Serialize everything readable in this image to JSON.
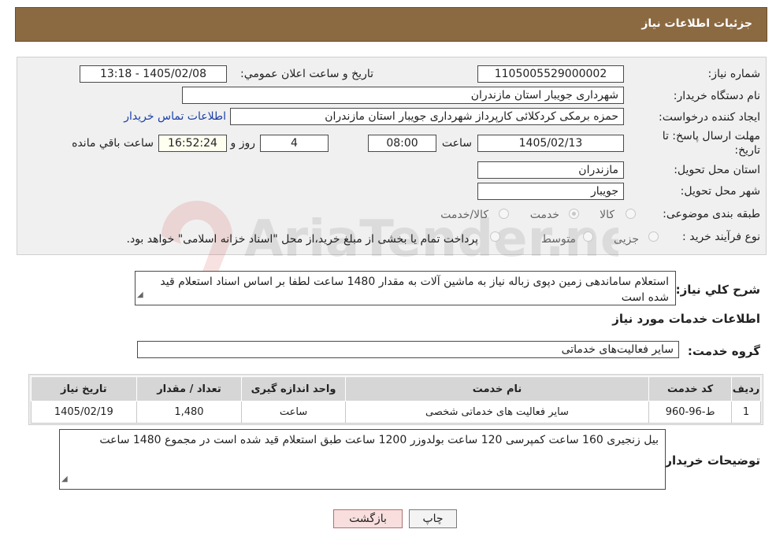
{
  "header": {
    "title": "جزئیات اطلاعات نیاز"
  },
  "form": {
    "need_number_label": "شماره نیاز:",
    "need_number": "1105005529000002",
    "announce_label": "تاريخ و ساعت اعلان عمومي:",
    "announce_value": "1405/02/08 - 13:18",
    "buyer_org_label": "نام دستگاه خریدار:",
    "buyer_org": "شهرداری جویبار استان مازندران",
    "creator_label": "ایجاد کننده درخواست:",
    "creator": "حمزه برمکی کردکلائی کارپرداز شهرداری جویبار استان مازندران",
    "contact_link": "اطلاعات تماس خریدار",
    "deadline_label_1": "مهلت ارسال پاسخ: تا",
    "deadline_label_2": "تاریخ:",
    "deadline_date": "1405/02/13",
    "hour_label": "ساعت",
    "deadline_time": "08:00",
    "days_value": "4",
    "days_label": "روز و",
    "remaining_time": "16:52:24",
    "remaining_label": "ساعت باقي مانده",
    "province_label": "استان محل تحویل:",
    "province": "مازندران",
    "city_label": "شهر محل تحویل:",
    "city": "جویبار",
    "category_label": "طبقه بندی موضوعی:",
    "category_options": [
      "کالا",
      "خدمت",
      "کالا/خدمت"
    ],
    "process_label": "نوع فرآیند خرید :",
    "process_options": [
      "جزیی",
      "متوسط"
    ],
    "process_note": "پرداخت تمام یا بخشی از مبلغ خرید،از محل \"اسناد خزانه اسلامی\" خواهد بود."
  },
  "description": {
    "label": "شرح کلي نياز:",
    "text": "استعلام ساماندهی زمین دپوی زباله نیاز به ماشین آلات به مقدار 1480 ساعت لطفا بر اساس اسناد استعلام قید شده است"
  },
  "services": {
    "section_title": "اطلاعات خدمات مورد نياز",
    "group_label": "گروه خدمت:",
    "group_value": "سایر فعالیت‌های خدماتی",
    "columns": [
      "رديف",
      "کد خدمت",
      "نام خدمت",
      "واحد اندازه گيری",
      "تعداد / مقدار",
      "تاريخ نياز"
    ],
    "rows": [
      [
        "1",
        "ط-96-960",
        "سایر فعالیت های خدماتی شخصی",
        "ساعت",
        "1,480",
        "1405/02/19"
      ]
    ]
  },
  "buyer_notes": {
    "label": "توضيحات خريدار:",
    "text": "بیل زنجیری 160 ساعت کمپرسی 120 ساعت بولدوزر 1200 ساعت طبق استعلام قید شده است در مجموع 1480 ساعت"
  },
  "buttons": {
    "print": "چاپ",
    "back": "بازگشت"
  },
  "watermark": {
    "text": "AriaTender.neT"
  },
  "colors": {
    "header_bg": "#8b6a42",
    "link": "#1a3fa8",
    "back_button_bg": "#f9dede"
  }
}
